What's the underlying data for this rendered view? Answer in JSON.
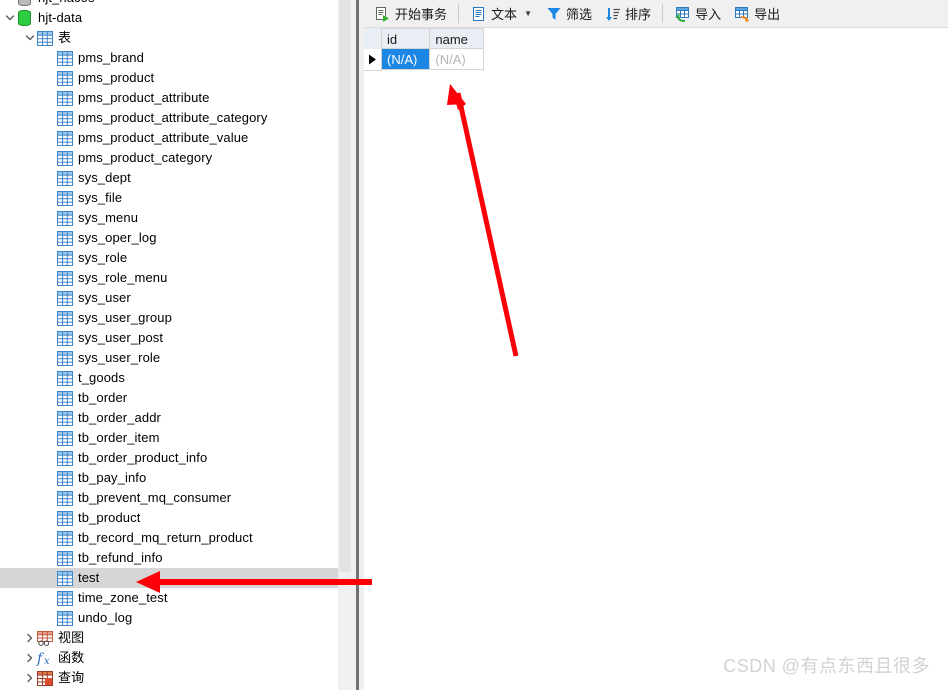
{
  "tree": {
    "items": [
      {
        "label": "hjt_nacos",
        "icon": "database-icon-gray",
        "indent": 20,
        "twisty": "none",
        "selected": false
      },
      {
        "label": "hjt-data",
        "icon": "database-icon-green",
        "indent": 20,
        "twisty": "expanded",
        "selected": false
      },
      {
        "label": "表",
        "icon": "table-folder-icon",
        "indent": 40,
        "twisty": "expanded",
        "selected": false
      },
      {
        "label": "pms_brand",
        "icon": "table-icon",
        "indent": 60,
        "twisty": "none",
        "selected": false
      },
      {
        "label": "pms_product",
        "icon": "table-icon",
        "indent": 60,
        "twisty": "none",
        "selected": false
      },
      {
        "label": "pms_product_attribute",
        "icon": "table-icon",
        "indent": 60,
        "twisty": "none",
        "selected": false
      },
      {
        "label": "pms_product_attribute_category",
        "icon": "table-icon",
        "indent": 60,
        "twisty": "none",
        "selected": false
      },
      {
        "label": "pms_product_attribute_value",
        "icon": "table-icon",
        "indent": 60,
        "twisty": "none",
        "selected": false
      },
      {
        "label": "pms_product_category",
        "icon": "table-icon",
        "indent": 60,
        "twisty": "none",
        "selected": false
      },
      {
        "label": "sys_dept",
        "icon": "table-icon",
        "indent": 60,
        "twisty": "none",
        "selected": false
      },
      {
        "label": "sys_file",
        "icon": "table-icon",
        "indent": 60,
        "twisty": "none",
        "selected": false
      },
      {
        "label": "sys_menu",
        "icon": "table-icon",
        "indent": 60,
        "twisty": "none",
        "selected": false
      },
      {
        "label": "sys_oper_log",
        "icon": "table-icon",
        "indent": 60,
        "twisty": "none",
        "selected": false
      },
      {
        "label": "sys_role",
        "icon": "table-icon",
        "indent": 60,
        "twisty": "none",
        "selected": false
      },
      {
        "label": "sys_role_menu",
        "icon": "table-icon",
        "indent": 60,
        "twisty": "none",
        "selected": false
      },
      {
        "label": "sys_user",
        "icon": "table-icon",
        "indent": 60,
        "twisty": "none",
        "selected": false
      },
      {
        "label": "sys_user_group",
        "icon": "table-icon",
        "indent": 60,
        "twisty": "none",
        "selected": false
      },
      {
        "label": "sys_user_post",
        "icon": "table-icon",
        "indent": 60,
        "twisty": "none",
        "selected": false
      },
      {
        "label": "sys_user_role",
        "icon": "table-icon",
        "indent": 60,
        "twisty": "none",
        "selected": false
      },
      {
        "label": "t_goods",
        "icon": "table-icon",
        "indent": 60,
        "twisty": "none",
        "selected": false
      },
      {
        "label": "tb_order",
        "icon": "table-icon",
        "indent": 60,
        "twisty": "none",
        "selected": false
      },
      {
        "label": "tb_order_addr",
        "icon": "table-icon",
        "indent": 60,
        "twisty": "none",
        "selected": false
      },
      {
        "label": "tb_order_item",
        "icon": "table-icon",
        "indent": 60,
        "twisty": "none",
        "selected": false
      },
      {
        "label": "tb_order_product_info",
        "icon": "table-icon",
        "indent": 60,
        "twisty": "none",
        "selected": false
      },
      {
        "label": "tb_pay_info",
        "icon": "table-icon",
        "indent": 60,
        "twisty": "none",
        "selected": false
      },
      {
        "label": "tb_prevent_mq_consumer",
        "icon": "table-icon",
        "indent": 60,
        "twisty": "none",
        "selected": false
      },
      {
        "label": "tb_product",
        "icon": "table-icon",
        "indent": 60,
        "twisty": "none",
        "selected": false
      },
      {
        "label": "tb_record_mq_return_product",
        "icon": "table-icon",
        "indent": 60,
        "twisty": "none",
        "selected": false
      },
      {
        "label": "tb_refund_info",
        "icon": "table-icon",
        "indent": 60,
        "twisty": "none",
        "selected": false
      },
      {
        "label": "test",
        "icon": "table-icon",
        "indent": 60,
        "twisty": "none",
        "selected": true
      },
      {
        "label": "time_zone_test",
        "icon": "table-icon",
        "indent": 60,
        "twisty": "none",
        "selected": false
      },
      {
        "label": "undo_log",
        "icon": "table-icon",
        "indent": 60,
        "twisty": "none",
        "selected": false
      },
      {
        "label": "视图",
        "icon": "view-icon",
        "indent": 40,
        "twisty": "collapsed",
        "selected": false
      },
      {
        "label": "函数",
        "icon": "function-icon",
        "indent": 40,
        "twisty": "collapsed",
        "selected": false
      },
      {
        "label": "查询",
        "icon": "query-icon",
        "indent": 40,
        "twisty": "collapsed",
        "selected": false
      }
    ]
  },
  "toolbar": {
    "begin_transaction": "开始事务",
    "text": "文本",
    "filter": "筛选",
    "sort": "排序",
    "import": "导入",
    "export": "导出"
  },
  "grid": {
    "columns": [
      "id",
      "name"
    ],
    "rows": [
      {
        "id": "(N/A)",
        "name": "(N/A)",
        "current": true
      }
    ]
  },
  "watermark": {
    "text": "CSDN @有点东西且很多"
  },
  "colors": {
    "selection_blue": "#1b86e3",
    "tree_selection_gray": "#d6d6d6",
    "annotation_red": "#fb0007",
    "table_icon_blue": "#4a93d9",
    "db_icon_green": "#13a93a"
  }
}
